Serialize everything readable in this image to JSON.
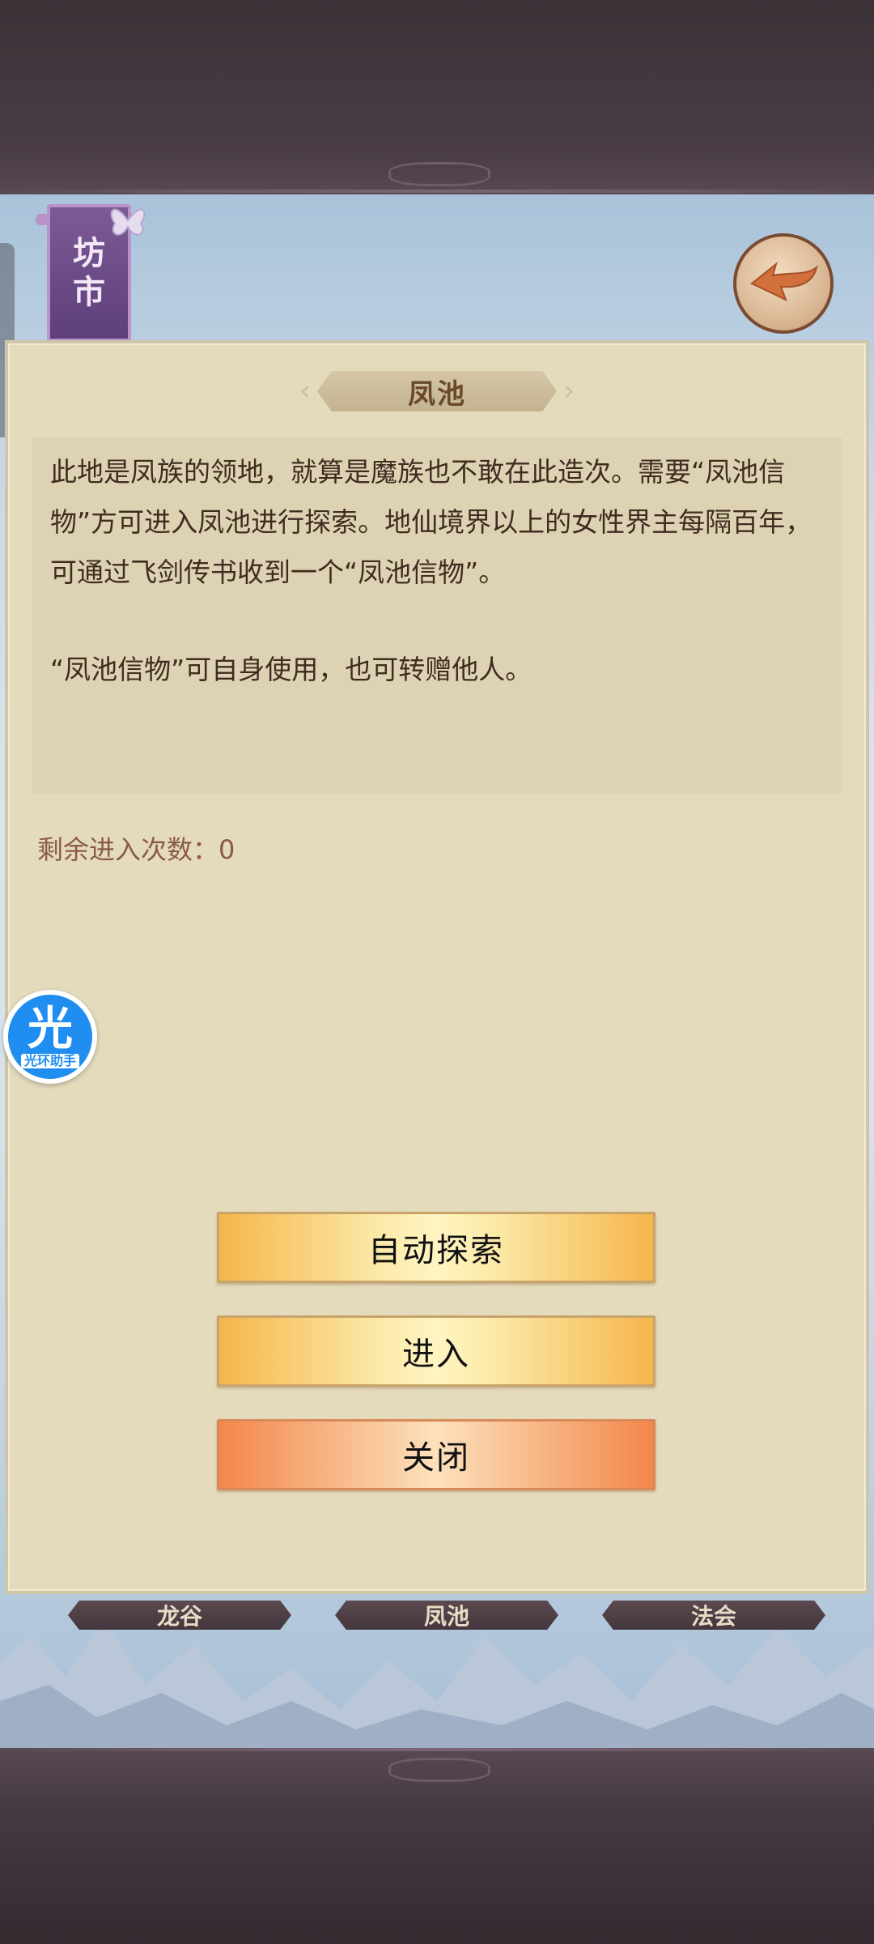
{
  "shop_banner": {
    "label_line1": "坊",
    "label_line2": "市"
  },
  "dialog": {
    "title": "凤池",
    "description_p1": "此地是凤族的领地，就算是魔族也不敢在此造次。需要“凤池信物”方可进入凤池进行探索。地仙境界以上的女性界主每隔百年，可通过飞剑传书收到一个“凤池信物”。",
    "description_p2": "“凤池信物”可自身使用，也可转赠他人。",
    "remaining_label": "剩余进入次数：",
    "remaining_value": "0"
  },
  "buttons": {
    "auto_explore": "自动探索",
    "enter": "进入",
    "close": "关闭"
  },
  "helper": {
    "glyph": "光",
    "name": "光环助手"
  },
  "bottom_tabs": [
    {
      "label": "龙谷"
    },
    {
      "label": "凤池"
    },
    {
      "label": "法会"
    }
  ],
  "icons": {
    "back": "back-arrow-icon",
    "helper": "helper-logo-icon"
  },
  "colors": {
    "accent_yellow": "#f5b54a",
    "accent_orange": "#f3874b",
    "panel_bg": "#e4dbbd"
  }
}
